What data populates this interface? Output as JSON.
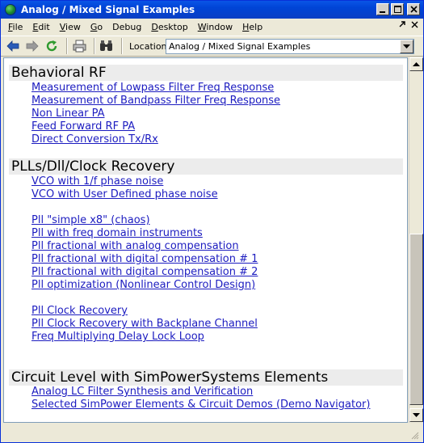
{
  "window": {
    "title": "Analog / Mixed Signal Examples"
  },
  "menu": {
    "items": [
      {
        "label": "File",
        "accel": "F",
        "rest": "ile"
      },
      {
        "label": "Edit",
        "accel": "E",
        "rest": "dit"
      },
      {
        "label": "View",
        "accel": "V",
        "rest": "iew"
      },
      {
        "label": "Go",
        "accel": "G",
        "rest": "o"
      },
      {
        "label": "Debug",
        "accel": "D",
        "rest": "ebug"
      },
      {
        "label": "Desktop",
        "accel": "D",
        "rest": "esktop"
      },
      {
        "label": "Window",
        "accel": "W",
        "rest": "indow"
      },
      {
        "label": "Help",
        "accel": "H",
        "rest": "elp"
      }
    ]
  },
  "toolbar": {
    "location_label": "Location:",
    "location_value": "Analog / Mixed Signal Examples",
    "icons": [
      "back-icon",
      "forward-icon",
      "refresh-icon",
      "print-icon",
      "find-icon"
    ]
  },
  "sections": [
    {
      "title": "Behavioral RF",
      "links": [
        "Measurement of Lowpass Filter Freq Response",
        "Measurement of Bandpass Filter Freq Response",
        "Non Linear PA",
        "Feed Forward RF PA",
        "Direct Conversion Tx/Rx"
      ]
    },
    {
      "title": "PLLs/Dll/Clock Recovery",
      "links": [
        "VCO with 1/f phase noise",
        "VCO with User Defined phase noise",
        "Pll \"simple x8\" (chaos)",
        "Pll with freq domain instruments",
        "Pll fractional with analog compensation",
        "Pll fractional with digital compensation # 1",
        "Pll fractional with digital compensation # 2",
        "Pll optimization (Nonlinear Control Design)",
        "Pll Clock Recovery",
        "Pll Clock Recovery with Backplane Channel",
        "Freq Multiplying Delay Lock Loop"
      ]
    },
    {
      "title": "Circuit Level with SimPowerSystems Elements",
      "links": [
        "Analog LC Filter Synthesis and Verification",
        "Selected SimPower Elements & Circuit Demos (Demo Navigator)"
      ]
    }
  ],
  "scrollbar": {
    "position_fraction": 0.9
  },
  "colors": {
    "link": "#1c1cc0",
    "titlebar": "#0a55e6",
    "header_bg": "#ececec"
  }
}
